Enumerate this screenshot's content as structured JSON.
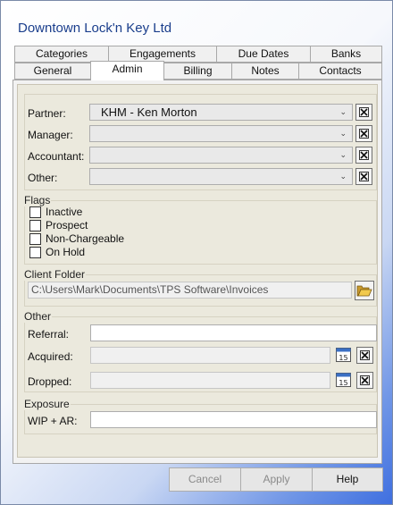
{
  "window": {
    "title": "Downtown Lock'n Key Ltd"
  },
  "tabs": {
    "row1": [
      "Categories",
      "Engagements",
      "Due Dates",
      "Banks"
    ],
    "row2": [
      "General",
      "Admin",
      "Billing",
      "Notes",
      "Contacts"
    ],
    "active": "Admin"
  },
  "staff": {
    "partner": {
      "label": "Partner:",
      "value": "KHM - Ken Morton"
    },
    "manager": {
      "label": "Manager:",
      "value": ""
    },
    "accountant": {
      "label": "Accountant:",
      "value": ""
    },
    "other": {
      "label": "Other:",
      "value": ""
    }
  },
  "flags": {
    "label": "Flags",
    "items": [
      {
        "label": "Inactive",
        "checked": false
      },
      {
        "label": "Prospect",
        "checked": false
      },
      {
        "label": "Non-Chargeable",
        "checked": false
      },
      {
        "label": "On Hold",
        "checked": false
      }
    ]
  },
  "client_folder": {
    "label": "Client Folder",
    "value": "C:\\Users\\Mark\\Documents\\TPS Software\\Invoices"
  },
  "other": {
    "label": "Other",
    "referral": {
      "label": "Referral:",
      "value": ""
    },
    "acquired": {
      "label": "Acquired:",
      "value": ""
    },
    "dropped": {
      "label": "Dropped:",
      "value": ""
    },
    "calendar_day": "15"
  },
  "exposure": {
    "label": "Exposure",
    "wip_ar": {
      "label": "WIP + AR:",
      "value": ""
    }
  },
  "buttons": {
    "cancel": "Cancel",
    "apply": "Apply",
    "help": "Help"
  },
  "colors": {
    "title": "#1a3e8c",
    "panel": "#ebe9dd"
  }
}
